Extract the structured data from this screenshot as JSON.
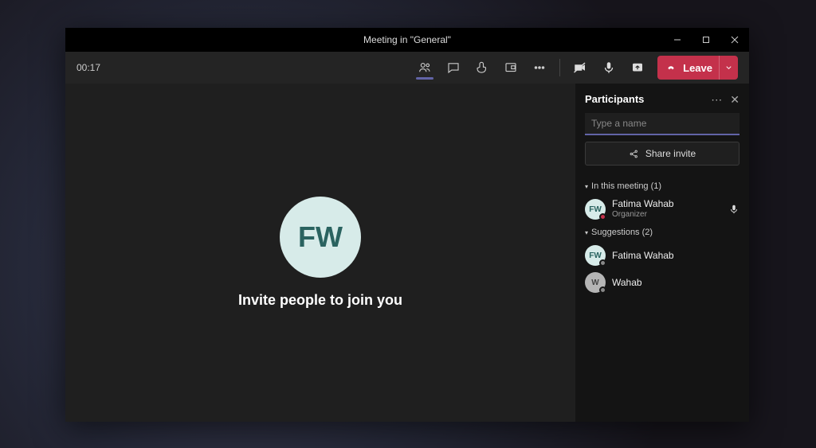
{
  "window": {
    "title": "Meeting in \"General\""
  },
  "toolbar": {
    "timer": "00:17",
    "leave_label": "Leave"
  },
  "stage": {
    "avatar_initials": "FW",
    "invite_message": "Invite people to join you"
  },
  "panel": {
    "title": "Participants",
    "search_placeholder": "Type a name",
    "share_label": "Share invite",
    "sections": {
      "in_meeting": {
        "label": "In this meeting (1)",
        "items": [
          {
            "name": "Fatima Wahab",
            "role": "Organizer",
            "initials": "FW",
            "presence": "busy",
            "has_mic": true
          }
        ]
      },
      "suggestions": {
        "label": "Suggestions (2)",
        "items": [
          {
            "name": "Fatima Wahab",
            "initials": "FW",
            "presence": "offline"
          },
          {
            "name": "Wahab",
            "initials": "W",
            "presence": "offline",
            "gray": true
          }
        ]
      }
    }
  }
}
